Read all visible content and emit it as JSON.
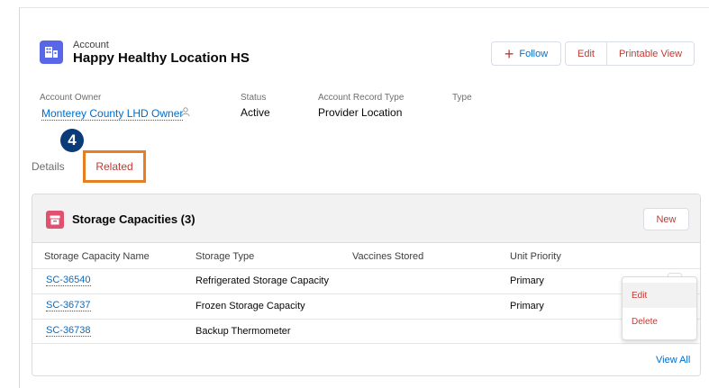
{
  "header": {
    "object_type": "Account",
    "record_name": "Happy Healthy Location HS",
    "buttons": {
      "follow": "Follow",
      "edit": "Edit",
      "printable_view": "Printable View"
    }
  },
  "fields": {
    "owner": {
      "label": "Account Owner",
      "value": "Monterey County LHD Owner"
    },
    "status": {
      "label": "Status",
      "value": "Active"
    },
    "record_type": {
      "label": "Account Record Type",
      "value": "Provider Location"
    },
    "type": {
      "label": "Type",
      "value": ""
    }
  },
  "step_badge": "4",
  "tabs": {
    "details": "Details",
    "related": "Related"
  },
  "related_list": {
    "title": "Storage Capacities (3)",
    "new_button": "New",
    "columns": [
      "Storage Capacity Name",
      "Storage Type",
      "Vaccines Stored",
      "Unit Priority"
    ],
    "rows": [
      {
        "name": "SC-36540",
        "type": "Refrigerated Storage Capacity",
        "vaccines": "",
        "priority": "Primary"
      },
      {
        "name": "SC-36737",
        "type": "Frozen Storage Capacity",
        "vaccines": "",
        "priority": "Primary"
      },
      {
        "name": "SC-36738",
        "type": "Backup Thermometer",
        "vaccines": "",
        "priority": ""
      }
    ],
    "view_all": "View All"
  },
  "row_menu": {
    "items": [
      "Edit",
      "Delete"
    ]
  },
  "colors": {
    "brand_icon": "#5867e8",
    "storage_icon": "#e0516f",
    "link": "#006dcc",
    "action_text": "#c23934",
    "highlight_border": "#e87e22",
    "badge": "#0b3b78"
  }
}
